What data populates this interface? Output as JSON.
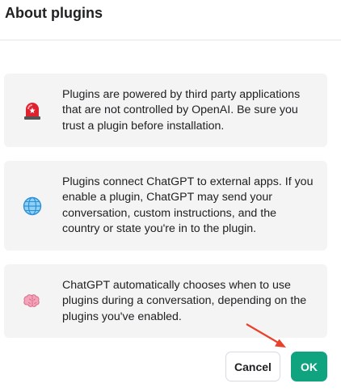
{
  "dialog": {
    "title": "About plugins",
    "cards": [
      {
        "icon": "siren-icon",
        "text": "Plugins are powered by third party applications that are not controlled by OpenAI. Be sure you trust a plugin before installation."
      },
      {
        "icon": "globe-icon",
        "text": "Plugins connect ChatGPT to external apps. If you enable a plugin, ChatGPT may send your conversation, custom instructions, and the country or state you're in to the plugin."
      },
      {
        "icon": "brain-icon",
        "text": "ChatGPT automatically chooses when to use plugins during a conversation, depending on the plugins you've enabled."
      }
    ],
    "cancel_label": "Cancel",
    "ok_label": "OK"
  },
  "colors": {
    "accent": "#10a37f",
    "card_bg": "#f4f4f4",
    "annotation_arrow": "#e8412c"
  }
}
